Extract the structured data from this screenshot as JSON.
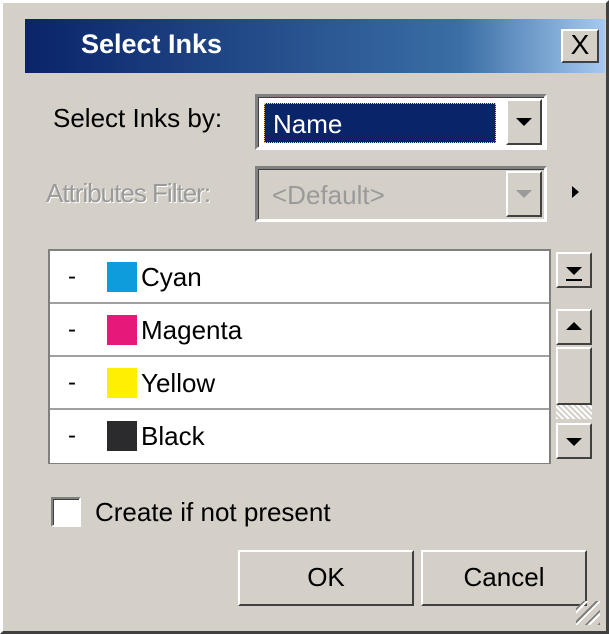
{
  "window": {
    "title": "Select Inks",
    "close_label": "X"
  },
  "select_by": {
    "label": "Select Inks by:",
    "value": "Name"
  },
  "attributes_filter": {
    "label": "Attributes Filter:",
    "value": "<Default>"
  },
  "inks": [
    {
      "dash": "-",
      "name": "Cyan",
      "color": "#0e9ddc"
    },
    {
      "dash": "-",
      "name": "Magenta",
      "color": "#e6197a"
    },
    {
      "dash": "-",
      "name": "Yellow",
      "color": "#ffef00"
    },
    {
      "dash": "-",
      "name": "Black",
      "color": "#2b2b2e"
    }
  ],
  "create_if_not_present": {
    "label": "Create if not present",
    "checked": false
  },
  "buttons": {
    "ok": "OK",
    "cancel": "Cancel"
  }
}
